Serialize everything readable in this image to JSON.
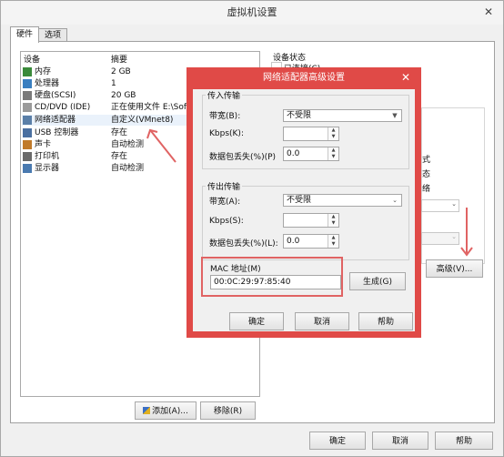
{
  "window": {
    "title": "虚拟机设置",
    "close": "✕"
  },
  "tabs": [
    "硬件",
    "选项"
  ],
  "device_list": {
    "headers": {
      "device": "设备",
      "summary": "摘要"
    },
    "rows": [
      {
        "name": "内存",
        "summary": "2 GB",
        "icon": "memory-icon",
        "color": "#3a8a3a"
      },
      {
        "name": "处理器",
        "summary": "1",
        "icon": "processor-icon",
        "color": "#3a7fc0"
      },
      {
        "name": "硬盘(SCSI)",
        "summary": "20 GB",
        "icon": "hard-disk-icon",
        "color": "#7a7a7a"
      },
      {
        "name": "CD/DVD (IDE)",
        "summary": "正在使用文件 E:\\Sof",
        "icon": "cd-dvd-icon",
        "color": "#9a9a9a"
      },
      {
        "name": "网络适配器",
        "summary": "自定义(VMnet8)",
        "icon": "network-adapter-icon",
        "color": "#5a7fa8"
      },
      {
        "name": "USB 控制器",
        "summary": "存在",
        "icon": "usb-icon",
        "color": "#4a6fa0"
      },
      {
        "name": "声卡",
        "summary": "自动检测",
        "icon": "sound-card-icon",
        "color": "#c07a2a"
      },
      {
        "name": "打印机",
        "summary": "存在",
        "icon": "printer-icon",
        "color": "#6a6a6a"
      },
      {
        "name": "显示器",
        "summary": "自动检测",
        "icon": "display-icon",
        "color": "#4a7ab0"
      }
    ]
  },
  "list_buttons": {
    "add": "添加(A)...",
    "remove": "移除(R)"
  },
  "right_panel": {
    "device_status": "设备状态",
    "connected_label": "已连接(C)",
    "advanced_button": "高级(V)..."
  },
  "bottom_buttons": {
    "ok": "确定",
    "cancel": "取消",
    "help": "帮助"
  },
  "modal": {
    "title": "网络适配器高级设置",
    "close": "✕",
    "incoming": {
      "group": "传入传输",
      "bandwidth_label": "带宽(B):",
      "bandwidth_value": "不受限",
      "kbps_label": "Kbps(K):",
      "kbps_value": "",
      "loss_label": "数据包丢失(%)(P)",
      "loss_value": "0.0"
    },
    "outgoing": {
      "group": "传出传输",
      "bandwidth_label": "带宽(A):",
      "bandwidth_value": "不受限",
      "kbps_label": "Kbps(S):",
      "kbps_value": "",
      "loss_label": "数据包丢失(%)(L):",
      "loss_value": "0.0"
    },
    "mac": {
      "label": "MAC 地址(M)",
      "value": "00:0C:29:97:85:40",
      "generate": "生成(G)"
    },
    "buttons": {
      "ok": "确定",
      "cancel": "取消",
      "help": "帮助"
    }
  },
  "colors": {
    "accent": "#e04a47",
    "annotation": "#e06363"
  }
}
